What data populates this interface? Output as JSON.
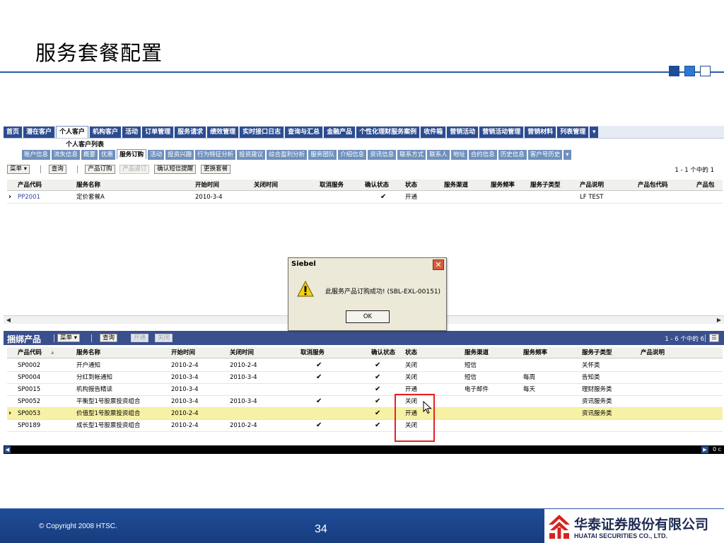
{
  "slide": {
    "title": "服务套餐配置",
    "copyright": "© Copyright 2008 HTSC.",
    "page_number": "34",
    "logo_cn": "华泰证券股份有限公司",
    "logo_en": "HUATAI SECURITIES CO., LTD."
  },
  "app": {
    "top_tabs": [
      "首页",
      "潜在客户",
      "个人客户",
      "机构客户",
      "活动",
      "订单管理",
      "服务请求",
      "绩效管理",
      "实时接口日志",
      "查询与汇总",
      "金融产品",
      "个性化理财服务案例",
      "收件箱",
      "营销活动",
      "营销活动管理",
      "营销材料",
      "列表管理"
    ],
    "top_tab_more": "▾",
    "screen_title": "个人客户列表",
    "sub_tabs": [
      "账户信息",
      "流失信息",
      "概要",
      "优惠",
      "服务订购",
      "活动",
      "投资兴趣",
      "行为特征分析",
      "投资建议",
      "综合盈利分析",
      "服务团队",
      "介绍信息",
      "资讯信息",
      "联系方式",
      "联系人",
      "地址",
      "合约信息",
      "历史信息",
      "客户号历史"
    ],
    "sub_tab_more": "▾",
    "applet1": {
      "menu_label": "菜单 ▾",
      "buttons": [
        "查询",
        "产品订购",
        "产品退订",
        "确认短信提醒",
        "更换套餐"
      ],
      "record_count": "1 - 1 个中的 1",
      "columns": [
        "产品代码",
        "服务名称",
        "开始时间",
        "关闭时间",
        "取消服务",
        "确认状态",
        "状态",
        "服务渠道",
        "服务频率",
        "服务子类型",
        "产品说明",
        "产品包代码",
        "产品包"
      ],
      "rows": [
        {
          "code": "PP2001",
          "name": "定价套餐A",
          "start": "2010-3-4",
          "end": "",
          "cancel": "",
          "confirm": "✔",
          "status": "开通",
          "channel": "",
          "freq": "",
          "subtype": "",
          "desc": "LF TEST",
          "pkg_code": "",
          "pkg": ""
        }
      ]
    },
    "applet2": {
      "title": "捆绑产品",
      "menu_label": "菜单 ▾",
      "buttons": [
        "查询",
        "开通",
        "关闭"
      ],
      "record_count": "1 - 6 个中的 6",
      "columns": [
        "产品代码",
        "服务名称",
        "开始时间",
        "关闭时间",
        "取消服务",
        "确认状态",
        "状态",
        "服务渠道",
        "服务频率",
        "服务子类型",
        "产品说明"
      ],
      "rows": [
        {
          "code": "SP0002",
          "name": "开户通知",
          "start": "2010-2-4",
          "end": "2010-2-4",
          "cancel": "✔",
          "confirm": "✔",
          "status": "关闭",
          "channel": "短信",
          "freq": "",
          "subtype": "关怀类",
          "desc": ""
        },
        {
          "code": "SP0004",
          "name": "分红到帐通知",
          "start": "2010-3-4",
          "end": "2010-3-4",
          "cancel": "✔",
          "confirm": "✔",
          "status": "关闭",
          "channel": "短信",
          "freq": "每周",
          "subtype": "告知类",
          "desc": ""
        },
        {
          "code": "SP0015",
          "name": "机构报告精读",
          "start": "2010-3-4",
          "end": "",
          "cancel": "",
          "confirm": "✔",
          "status": "开通",
          "channel": "电子邮件",
          "freq": "每天",
          "subtype": "理财服务类",
          "desc": ""
        },
        {
          "code": "SP0052",
          "name": "平衡型1号股票投资组合",
          "start": "2010-3-4",
          "end": "2010-3-4",
          "cancel": "✔",
          "confirm": "✔",
          "status": "关闭",
          "channel": "",
          "freq": "",
          "subtype": "资讯服务类",
          "desc": ""
        },
        {
          "code": "SP0053",
          "name": "价值型1号股票投资组合",
          "start": "2010-2-4",
          "end": "",
          "cancel": "",
          "confirm": "✔",
          "status": "开通",
          "channel": "",
          "freq": "",
          "subtype": "资讯服务类",
          "desc": ""
        },
        {
          "code": "SP0189",
          "name": "成长型1号股票投资组合",
          "start": "2010-2-4",
          "end": "2010-2-4",
          "cancel": "✔",
          "confirm": "✔",
          "status": "关闭",
          "channel": "",
          "freq": "",
          "subtype": "",
          "desc": ""
        }
      ],
      "selected_row": 4
    },
    "bottom_text": "0 c",
    "dialog": {
      "title": "Siebel",
      "message": "此服务产品订购成功! (SBL-EXL-00151)",
      "ok_label": "OK"
    }
  },
  "colors": {
    "tab_blue": "#2c4c8f",
    "subtab_blue": "#6f90bd",
    "applet_header": "#3a4f8d",
    "selected_row": "#f7f1a5",
    "highlight_red": "#e42323"
  }
}
